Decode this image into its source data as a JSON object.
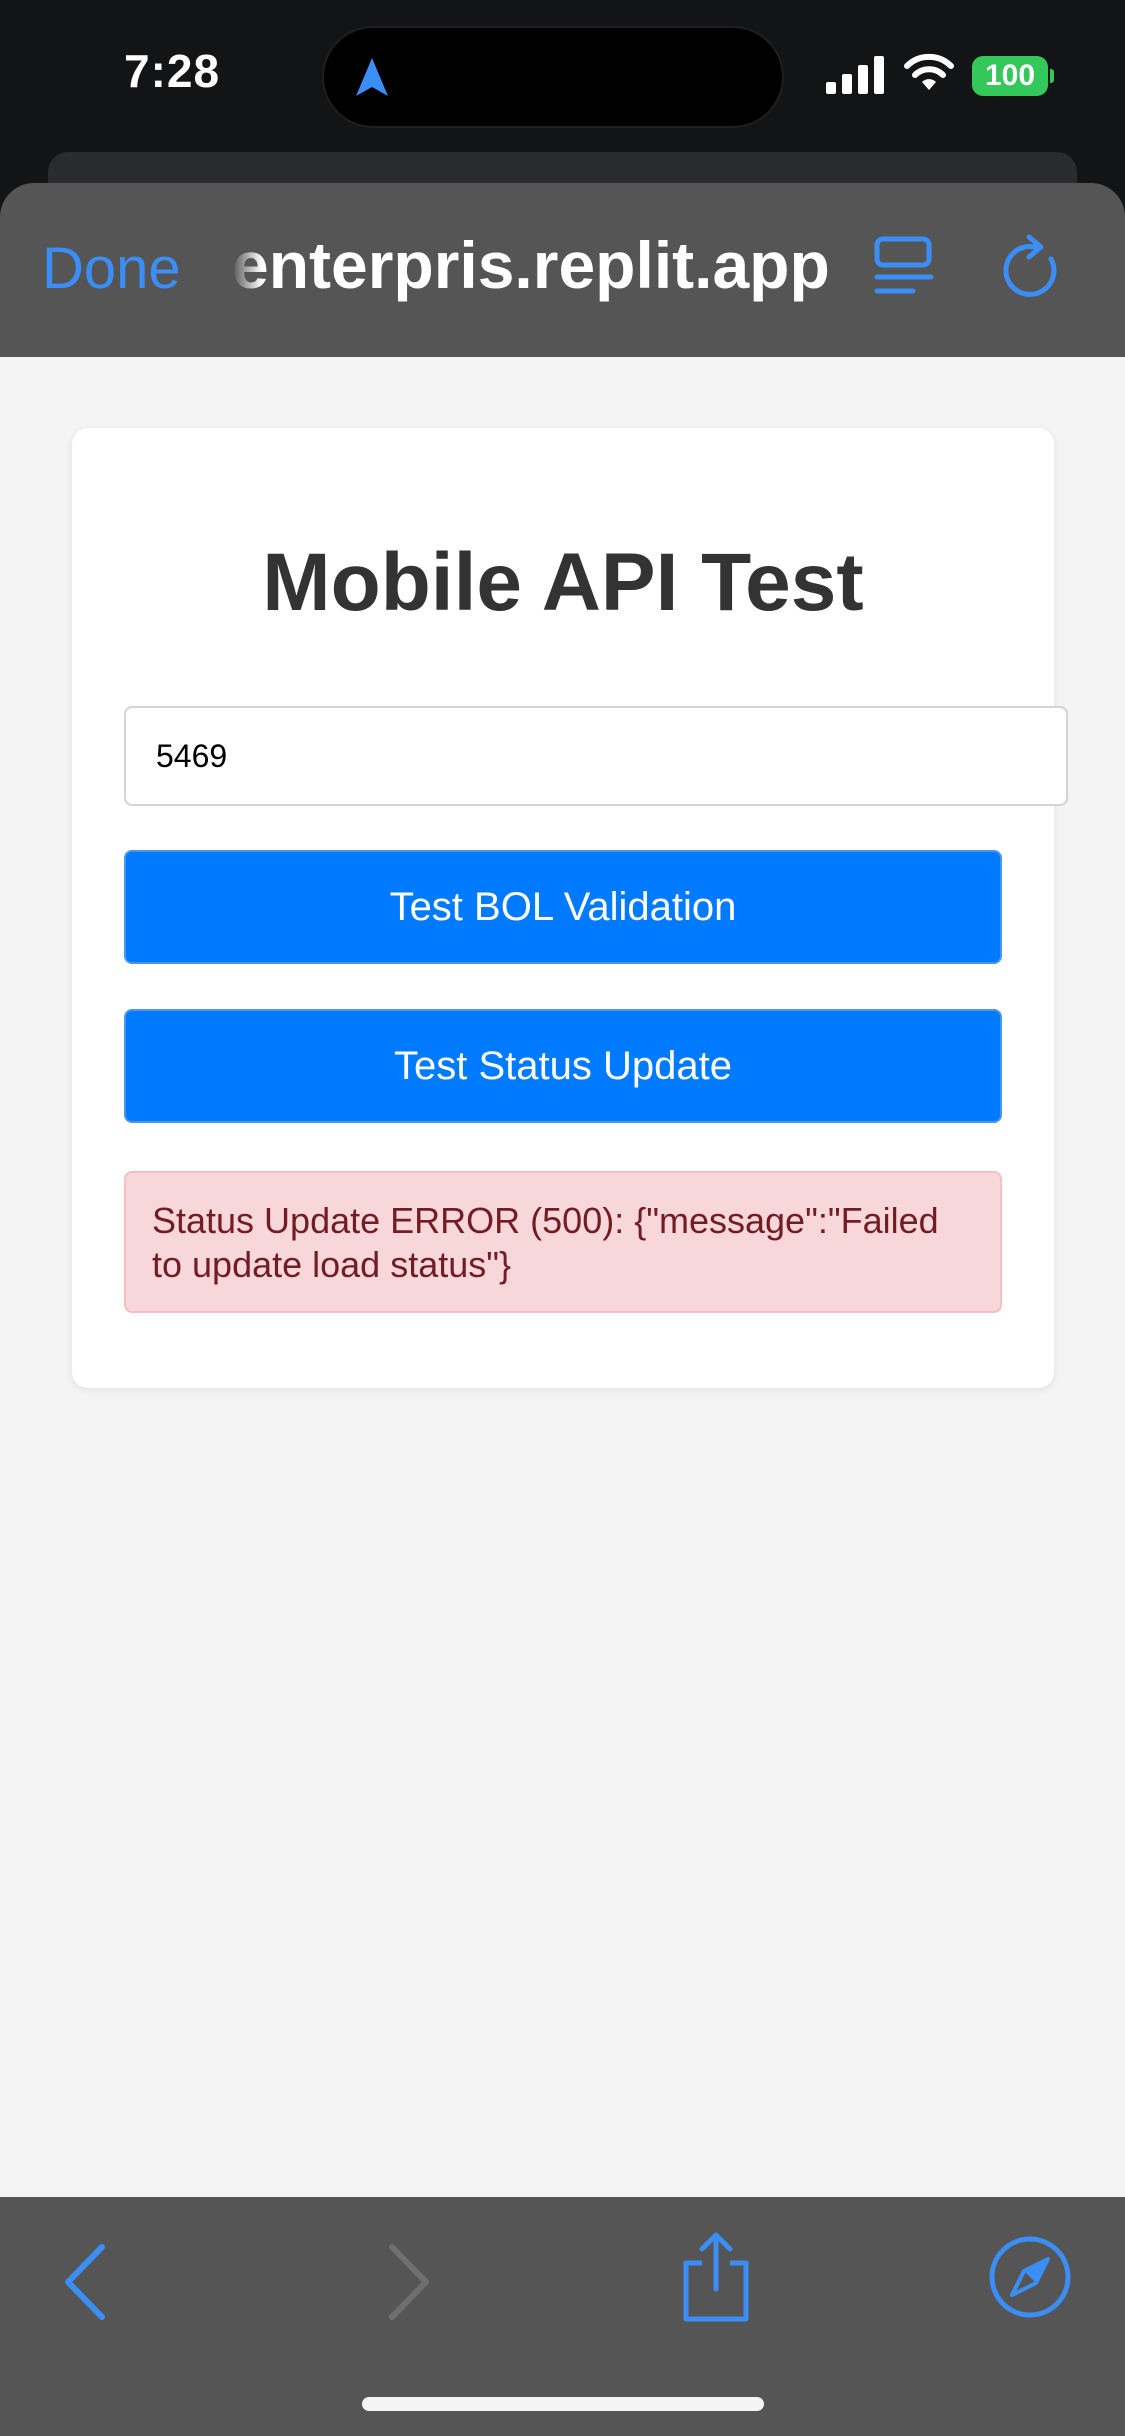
{
  "status_bar": {
    "time": "7:28",
    "battery": "100",
    "icons": [
      "location-arrow-icon",
      "cellular-signal-icon",
      "wifi-icon",
      "battery-icon"
    ]
  },
  "browser": {
    "done_label": "Done",
    "url": "enterpris.replit.app",
    "icons": [
      "reader-mode-icon",
      "reload-icon",
      "back-arrow-icon",
      "forward-arrow-icon",
      "share-icon",
      "compass-icon"
    ],
    "accent_color": "#3b8ef5"
  },
  "page": {
    "title": "Mobile API Test",
    "bol_input_value": "5469",
    "buttons": {
      "bol_validation": "Test BOL Validation",
      "status_update": "Test Status Update"
    },
    "result_message": "Status Update ERROR (500): {\"message\":\"Failed to update load status\"}",
    "colors": {
      "button": "#007aff",
      "error_bg": "#f8d7da",
      "error_text": "#721c24"
    }
  }
}
